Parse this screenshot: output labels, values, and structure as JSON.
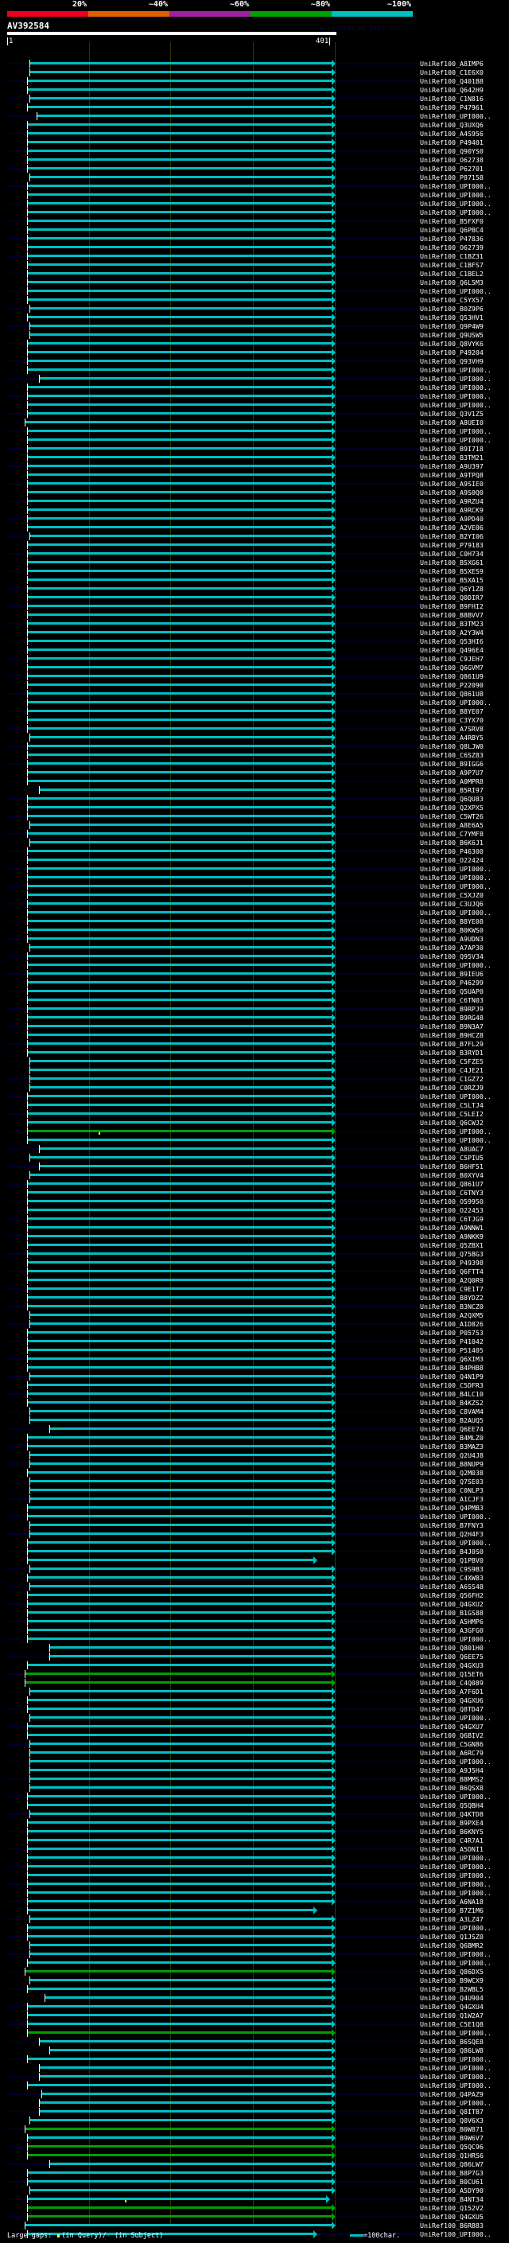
{
  "scale": {
    "labels": [
      "20%",
      "~40%",
      "~60%",
      "~80%",
      "~100%"
    ],
    "colors": [
      "#f00020",
      "#e06000",
      "#a020a0",
      "#00a000",
      "#00c0c0"
    ]
  },
  "query": {
    "name": "AV392584",
    "start": "1",
    "end": "401",
    "length": 401
  },
  "watermark": "AlignView.pm Beta rel.7",
  "colors": {
    "cyan": "#00c0c0",
    "green": "#00a000",
    "stripe": "#000028",
    "gap": "#ffff40"
  },
  "defaults": {
    "end": 396,
    "color": "cyan"
  },
  "rows": [
    {
      "label": "UniRef100_A8IMP6",
      "start": 28
    },
    {
      "label": "UniRef100_C1E6X0",
      "start": 28
    },
    {
      "label": "UniRef100_Q401B8",
      "start": 25
    },
    {
      "label": "UniRef100_Q642H9",
      "start": 25
    },
    {
      "label": "UniRef100_C1N816",
      "start": 28
    },
    {
      "label": "UniRef100_P47961",
      "start": 25
    },
    {
      "label": "UniRef100_UPI000..",
      "start": 37
    },
    {
      "label": "UniRef100_Q3UXQ6",
      "start": 25
    },
    {
      "label": "UniRef100_A4S956",
      "start": 25
    },
    {
      "label": "UniRef100_P49401",
      "start": 25
    },
    {
      "label": "UniRef100_Q90YS0",
      "start": 25
    },
    {
      "label": "UniRef100_O62738",
      "start": 25
    },
    {
      "label": "UniRef100_P62701",
      "start": 25
    },
    {
      "label": "UniRef100_P87158",
      "start": 28
    },
    {
      "label": "UniRef100_UPI000..",
      "start": 25
    },
    {
      "label": "UniRef100_UPI000..",
      "start": 25
    },
    {
      "label": "UniRef100_UPI000..",
      "start": 25
    },
    {
      "label": "UniRef100_UPI000..",
      "start": 25
    },
    {
      "label": "UniRef100_B5FXF0",
      "start": 25
    },
    {
      "label": "UniRef100_Q6PBC4",
      "start": 25
    },
    {
      "label": "UniRef100_P47836",
      "start": 25
    },
    {
      "label": "UniRef100_O62739",
      "start": 25
    },
    {
      "label": "UniRef100_C1BZ31",
      "start": 25
    },
    {
      "label": "UniRef100_C1BFS7",
      "start": 25
    },
    {
      "label": "UniRef100_C1BEL2",
      "start": 25
    },
    {
      "label": "UniRef100_Q6L5M3",
      "start": 25
    },
    {
      "label": "UniRef100_UPI000..",
      "start": 25
    },
    {
      "label": "UniRef100_C5YX57",
      "start": 25
    },
    {
      "label": "UniRef100_B0Z9P6",
      "start": 28
    },
    {
      "label": "UniRef100_Q53HV1",
      "start": 25
    },
    {
      "label": "UniRef100_Q9P4W9",
      "start": 28
    },
    {
      "label": "UniRef100_Q9USW5",
      "start": 28
    },
    {
      "label": "UniRef100_Q8VYK6",
      "start": 25
    },
    {
      "label": "UniRef100_P49204",
      "start": 25
    },
    {
      "label": "UniRef100_Q93VH9",
      "start": 25
    },
    {
      "label": "UniRef100_UPI000..",
      "start": 25
    },
    {
      "label": "UniRef100_UPI000..",
      "start": 40
    },
    {
      "label": "UniRef100_UPI000..",
      "start": 25
    },
    {
      "label": "UniRef100_UPI000..",
      "start": 25
    },
    {
      "label": "UniRef100_UPI000..",
      "start": 25
    },
    {
      "label": "UniRef100_Q3V1Z5",
      "start": 25
    },
    {
      "label": "UniRef100_A8UEI0",
      "start": 22
    },
    {
      "label": "UniRef100_UPI000..",
      "start": 25
    },
    {
      "label": "UniRef100_UPI000..",
      "start": 25
    },
    {
      "label": "UniRef100_B9I718",
      "start": 25
    },
    {
      "label": "UniRef100_B3TM21",
      "start": 25
    },
    {
      "label": "UniRef100_A9U397",
      "start": 25
    },
    {
      "label": "UniRef100_A9TPQ8",
      "start": 25
    },
    {
      "label": "UniRef100_A9SIE0",
      "start": 25
    },
    {
      "label": "UniRef100_A9S0Q0",
      "start": 25
    },
    {
      "label": "UniRef100_A9RZU4",
      "start": 25
    },
    {
      "label": "UniRef100_A9RCK9",
      "start": 25
    },
    {
      "label": "UniRef100_A9PD40",
      "start": 25
    },
    {
      "label": "UniRef100_A2VE06",
      "start": 25
    },
    {
      "label": "UniRef100_B2YI06",
      "start": 28
    },
    {
      "label": "UniRef100_P79183",
      "start": 25
    },
    {
      "label": "UniRef100_C0H734",
      "start": 25
    },
    {
      "label": "UniRef100_B5XG61",
      "start": 25
    },
    {
      "label": "UniRef100_B5XES9",
      "start": 25
    },
    {
      "label": "UniRef100_B5XA15",
      "start": 25
    },
    {
      "label": "UniRef100_Q6Y1Z8",
      "start": 25
    },
    {
      "label": "UniRef100_Q0DIR7",
      "start": 25
    },
    {
      "label": "UniRef100_B9FHI2",
      "start": 25
    },
    {
      "label": "UniRef100_B8BVV7",
      "start": 25
    },
    {
      "label": "UniRef100_B3TM23",
      "start": 25
    },
    {
      "label": "UniRef100_A2Y3W4",
      "start": 25
    },
    {
      "label": "UniRef100_Q53HI6",
      "start": 25
    },
    {
      "label": "UniRef100_Q496E4",
      "start": 25
    },
    {
      "label": "UniRef100_C9JEH7",
      "start": 25
    },
    {
      "label": "UniRef100_Q6GVM7",
      "start": 25
    },
    {
      "label": "UniRef100_Q861U9",
      "start": 25
    },
    {
      "label": "UniRef100_P22090",
      "start": 25
    },
    {
      "label": "UniRef100_Q861U8",
      "start": 25
    },
    {
      "label": "UniRef100_UPI000..",
      "start": 25
    },
    {
      "label": "UniRef100_B8YE07",
      "start": 25
    },
    {
      "label": "UniRef100_C3YX70",
      "start": 25
    },
    {
      "label": "UniRef100_A7SRV8",
      "start": 25
    },
    {
      "label": "UniRef100_A4RBY5",
      "start": 28
    },
    {
      "label": "UniRef100_Q8LJW0",
      "start": 25
    },
    {
      "label": "UniRef100_C6SZ83",
      "start": 25
    },
    {
      "label": "UniRef100_B9IGG6",
      "start": 25
    },
    {
      "label": "UniRef100_A9P7U7",
      "start": 25
    },
    {
      "label": "UniRef100_A0MPR8",
      "start": 25
    },
    {
      "label": "UniRef100_B5RI97",
      "start": 40
    },
    {
      "label": "UniRef100_Q6QU83",
      "start": 25
    },
    {
      "label": "UniRef100_Q2XPX5",
      "start": 25
    },
    {
      "label": "UniRef100_C5WT26",
      "start": 25
    },
    {
      "label": "UniRef100_A8E6A5",
      "start": 28
    },
    {
      "label": "UniRef100_C7YMF8",
      "start": 25
    },
    {
      "label": "UniRef100_B6K6J1",
      "start": 28
    },
    {
      "label": "UniRef100_P46300",
      "start": 25
    },
    {
      "label": "UniRef100_O22424",
      "start": 25
    },
    {
      "label": "UniRef100_UPI000..",
      "start": 25
    },
    {
      "label": "UniRef100_UPI000..",
      "start": 25
    },
    {
      "label": "UniRef100_UPI000..",
      "start": 25
    },
    {
      "label": "UniRef100_C5XJZ0",
      "start": 25
    },
    {
      "label": "UniRef100_C3UJQ6",
      "start": 25
    },
    {
      "label": "UniRef100_UPI000..",
      "start": 25
    },
    {
      "label": "UniRef100_B8YE08",
      "start": 25
    },
    {
      "label": "UniRef100_B0KWS0",
      "start": 25
    },
    {
      "label": "UniRef100_A9UDN3",
      "start": 25
    },
    {
      "label": "UniRef100_A7AP30",
      "start": 28
    },
    {
      "label": "UniRef100_Q95V34",
      "start": 25
    },
    {
      "label": "UniRef100_UPI000..",
      "start": 25
    },
    {
      "label": "UniRef100_B9IEU6",
      "start": 25
    },
    {
      "label": "UniRef100_P46299",
      "start": 25
    },
    {
      "label": "UniRef100_Q5UAP0",
      "start": 25
    },
    {
      "label": "UniRef100_C6TN03",
      "start": 25
    },
    {
      "label": "UniRef100_B9RPJ9",
      "start": 25
    },
    {
      "label": "UniRef100_B9RG48",
      "start": 25
    },
    {
      "label": "UniRef100_B9N3A7",
      "start": 25
    },
    {
      "label": "UniRef100_B9HCZ8",
      "start": 25
    },
    {
      "label": "UniRef100_B7FL29",
      "start": 25
    },
    {
      "label": "UniRef100_B3RYD1",
      "start": 25
    },
    {
      "label": "UniRef100_C5FZE5",
      "start": 28
    },
    {
      "label": "UniRef100_C4JE21",
      "start": 28
    },
    {
      "label": "UniRef100_C1GZ72",
      "start": 28
    },
    {
      "label": "UniRef100_C0RZJ9",
      "start": 28
    },
    {
      "label": "UniRef100_UPI000..",
      "start": 25
    },
    {
      "label": "UniRef100_C5LTJ4",
      "start": 25
    },
    {
      "label": "UniRef100_C5LEI2",
      "start": 25
    },
    {
      "label": "UniRef100_Q6CWJ2",
      "start": 25
    },
    {
      "label": "UniRef100_UPI000..",
      "start": 25,
      "color": "green",
      "gap": 112
    },
    {
      "label": "UniRef100_UPI000..",
      "start": 25
    },
    {
      "label": "UniRef100_A8UAC7",
      "start": 40
    },
    {
      "label": "UniRef100_C5PIU5",
      "start": 28
    },
    {
      "label": "UniRef100_B6HF51",
      "start": 40
    },
    {
      "label": "UniRef100_B0XYV4",
      "start": 28
    },
    {
      "label": "UniRef100_Q861U7",
      "start": 25
    },
    {
      "label": "UniRef100_C6TNY3",
      "start": 25
    },
    {
      "label": "UniRef100_O59950",
      "start": 25
    },
    {
      "label": "UniRef100_O22453",
      "start": 25
    },
    {
      "label": "UniRef100_C6TJG9",
      "start": 25
    },
    {
      "label": "UniRef100_A9NNW1",
      "start": 25
    },
    {
      "label": "UniRef100_A9NKK9",
      "start": 25
    },
    {
      "label": "UniRef100_Q5ZBX1",
      "start": 25
    },
    {
      "label": "UniRef100_Q75BG3",
      "start": 25
    },
    {
      "label": "UniRef100_P49398",
      "start": 25
    },
    {
      "label": "UniRef100_Q6FTT4",
      "start": 25
    },
    {
      "label": "UniRef100_A2Q0R9",
      "start": 25
    },
    {
      "label": "UniRef100_C9E1T7",
      "start": 25
    },
    {
      "label": "UniRef100_B8YDZ2",
      "start": 25
    },
    {
      "label": "UniRef100_B3NCZ0",
      "start": 25
    },
    {
      "label": "UniRef100_A2QXM5",
      "start": 28
    },
    {
      "label": "UniRef100_A1D826",
      "start": 28
    },
    {
      "label": "UniRef100_P05753",
      "start": 25
    },
    {
      "label": "UniRef100_P41042",
      "start": 25
    },
    {
      "label": "UniRef100_P51405",
      "start": 25
    },
    {
      "label": "UniRef100_Q6XIM3",
      "start": 25
    },
    {
      "label": "UniRef100_B4PHB8",
      "start": 25
    },
    {
      "label": "UniRef100_Q4N1P9",
      "start": 28
    },
    {
      "label": "UniRef100_C5DFR3",
      "start": 25
    },
    {
      "label": "UniRef100_B4LC10",
      "start": 25
    },
    {
      "label": "UniRef100_B4KZS2",
      "start": 25
    },
    {
      "label": "UniRef100_C8VAM4",
      "start": 28
    },
    {
      "label": "UniRef100_B2AUQ5",
      "start": 28
    },
    {
      "label": "UniRef100_Q6EE74",
      "start": 52
    },
    {
      "label": "UniRef100_B4MLZ0",
      "start": 25
    },
    {
      "label": "UniRef100_B3MAZ3",
      "start": 25
    },
    {
      "label": "UniRef100_Q2U4J8",
      "start": 28
    },
    {
      "label": "UniRef100_B8NUP9",
      "start": 28
    },
    {
      "label": "UniRef100_Q2M038",
      "start": 25
    },
    {
      "label": "UniRef100_Q7SE03",
      "start": 28
    },
    {
      "label": "UniRef100_C0NLP3",
      "start": 28
    },
    {
      "label": "UniRef100_A1CJF3",
      "start": 28
    },
    {
      "label": "UniRef100_Q4PMB3",
      "start": 25
    },
    {
      "label": "UniRef100_UPI000..",
      "start": 25
    },
    {
      "label": "UniRef100_B7FNY3",
      "start": 28
    },
    {
      "label": "UniRef100_Q2H4F3",
      "start": 28
    },
    {
      "label": "UniRef100_UPI000..",
      "start": 25
    },
    {
      "label": "UniRef100_B4J0S0",
      "start": 25
    },
    {
      "label": "UniRef100_Q1PBV0",
      "start": 25,
      "end": 374
    },
    {
      "label": "UniRef100_C9S9B3",
      "start": 28
    },
    {
      "label": "UniRef100_C4XW83",
      "start": 25
    },
    {
      "label": "UniRef100_A6SS48",
      "start": 28
    },
    {
      "label": "UniRef100_Q56FH2",
      "start": 25
    },
    {
      "label": "UniRef100_Q4GXU2",
      "start": 25
    },
    {
      "label": "UniRef100_B1GS88",
      "start": 25
    },
    {
      "label": "UniRef100_A5HMP6",
      "start": 25
    },
    {
      "label": "UniRef100_A3GFG0",
      "start": 25
    },
    {
      "label": "UniRef100_UPI000..",
      "start": 25
    },
    {
      "label": "UniRef100_Q801H0",
      "start": 52
    },
    {
      "label": "UniRef100_Q6EE75",
      "start": 52
    },
    {
      "label": "UniRef100_Q4GXU3",
      "start": 25
    },
    {
      "label": "UniRef100_Q15ET6",
      "start": 22,
      "color": "green"
    },
    {
      "label": "UniRef100_C4Q089",
      "start": 22,
      "color": "green"
    },
    {
      "label": "UniRef100_A7F6D1",
      "start": 28
    },
    {
      "label": "UniRef100_Q4GXU6",
      "start": 25
    },
    {
      "label": "UniRef100_Q8TD47",
      "start": 25
    },
    {
      "label": "UniRef100_UPI000..",
      "start": 28
    },
    {
      "label": "UniRef100_Q4GXU7",
      "start": 25
    },
    {
      "label": "UniRef100_Q6BIV2",
      "start": 25
    },
    {
      "label": "UniRef100_C5GN86",
      "start": 28
    },
    {
      "label": "UniRef100_A6RC79",
      "start": 28
    },
    {
      "label": "UniRef100_UPI000..",
      "start": 28
    },
    {
      "label": "UniRef100_A9J5H4",
      "start": 28
    },
    {
      "label": "UniRef100_B8MMS2",
      "start": 28
    },
    {
      "label": "UniRef100_B6QSX8",
      "start": 28
    },
    {
      "label": "UniRef100_UPI000..",
      "start": 25
    },
    {
      "label": "UniRef100_Q5QBH4",
      "start": 25
    },
    {
      "label": "UniRef100_Q4KTD8",
      "start": 28
    },
    {
      "label": "UniRef100_B9PXE4",
      "start": 25
    },
    {
      "label": "UniRef100_B6KNY5",
      "start": 25
    },
    {
      "label": "UniRef100_C4R7A1",
      "start": 25
    },
    {
      "label": "UniRef100_A5DNI1",
      "start": 25
    },
    {
      "label": "UniRef100_UPI000..",
      "start": 25
    },
    {
      "label": "UniRef100_UPI000..",
      "start": 25
    },
    {
      "label": "UniRef100_UPI000..",
      "start": 25
    },
    {
      "label": "UniRef100_UPI000..",
      "start": 25
    },
    {
      "label": "UniRef100_UPI000..",
      "start": 25
    },
    {
      "label": "UniRef100_A6NA18",
      "start": 25
    },
    {
      "label": "UniRef100_B7Z1M6",
      "start": 25,
      "end": 374
    },
    {
      "label": "UniRef100_A3LZ47",
      "start": 28
    },
    {
      "label": "UniRef100_UPI000..",
      "start": 25
    },
    {
      "label": "UniRef100_Q1JSZ0",
      "start": 25
    },
    {
      "label": "UniRef100_Q6BMR2",
      "start": 28
    },
    {
      "label": "UniRef100_UPI000..",
      "start": 28
    },
    {
      "label": "UniRef100_UPI000..",
      "start": 25
    },
    {
      "label": "UniRef100_Q86DX5",
      "start": 22,
      "color": "green"
    },
    {
      "label": "UniRef100_B9WCX9",
      "start": 28
    },
    {
      "label": "UniRef100_B2WBL5",
      "start": 25
    },
    {
      "label": "UniRef100_Q4U904",
      "start": 46
    },
    {
      "label": "UniRef100_Q4GXU4",
      "start": 25
    },
    {
      "label": "UniRef100_Q1W2A7",
      "start": 25
    },
    {
      "label": "UniRef100_C5E1Q8",
      "start": 25
    },
    {
      "label": "UniRef100_UPI000..",
      "start": 25,
      "color": "green"
    },
    {
      "label": "UniRef100_B6SQE8",
      "start": 40
    },
    {
      "label": "UniRef100_Q86LW8",
      "start": 52
    },
    {
      "label": "UniRef100_UPI000..",
      "start": 25
    },
    {
      "label": "UniRef100_UPI000..",
      "start": 40
    },
    {
      "label": "UniRef100_UPI000..",
      "start": 40
    },
    {
      "label": "UniRef100_UPI000..",
      "start": 25
    },
    {
      "label": "UniRef100_Q4PAZ9",
      "start": 43
    },
    {
      "label": "UniRef100_UPI000..",
      "start": 40
    },
    {
      "label": "UniRef100_Q8ITB7",
      "start": 40
    },
    {
      "label": "UniRef100_Q0V6X3",
      "start": 28
    },
    {
      "label": "UniRef100_B0W871",
      "start": 22,
      "color": "green"
    },
    {
      "label": "UniRef100_B9W6V7",
      "start": 25
    },
    {
      "label": "UniRef100_Q5QC96",
      "start": 25,
      "color": "green"
    },
    {
      "label": "UniRef100_Q1HRS6",
      "start": 25,
      "color": "green"
    },
    {
      "label": "UniRef100_Q86LW7",
      "start": 52
    },
    {
      "label": "UniRef100_B8P7G3",
      "start": 25
    },
    {
      "label": "UniRef100_B0CU61",
      "start": 25
    },
    {
      "label": "UniRef100_A5DY90",
      "start": 28
    },
    {
      "label": "UniRef100_B4NT34",
      "start": 25,
      "end": 389,
      "gap": 144
    },
    {
      "label": "UniRef100_Q152V2",
      "start": 25,
      "color": "green"
    },
    {
      "label": "UniRef100_Q4GXU5",
      "start": 25,
      "color": "green"
    },
    {
      "label": "UniRef100_B6RB83",
      "start": 22
    },
    {
      "label": "UniRef100_UPI000..",
      "start": 25,
      "end": 374
    }
  ],
  "footer": {
    "large_gaps": "Large gaps:",
    "in_query": "(in Query)/",
    "subject_mark": "-",
    "in_subject": "(in Subject)",
    "scale_legend": "=100char."
  }
}
